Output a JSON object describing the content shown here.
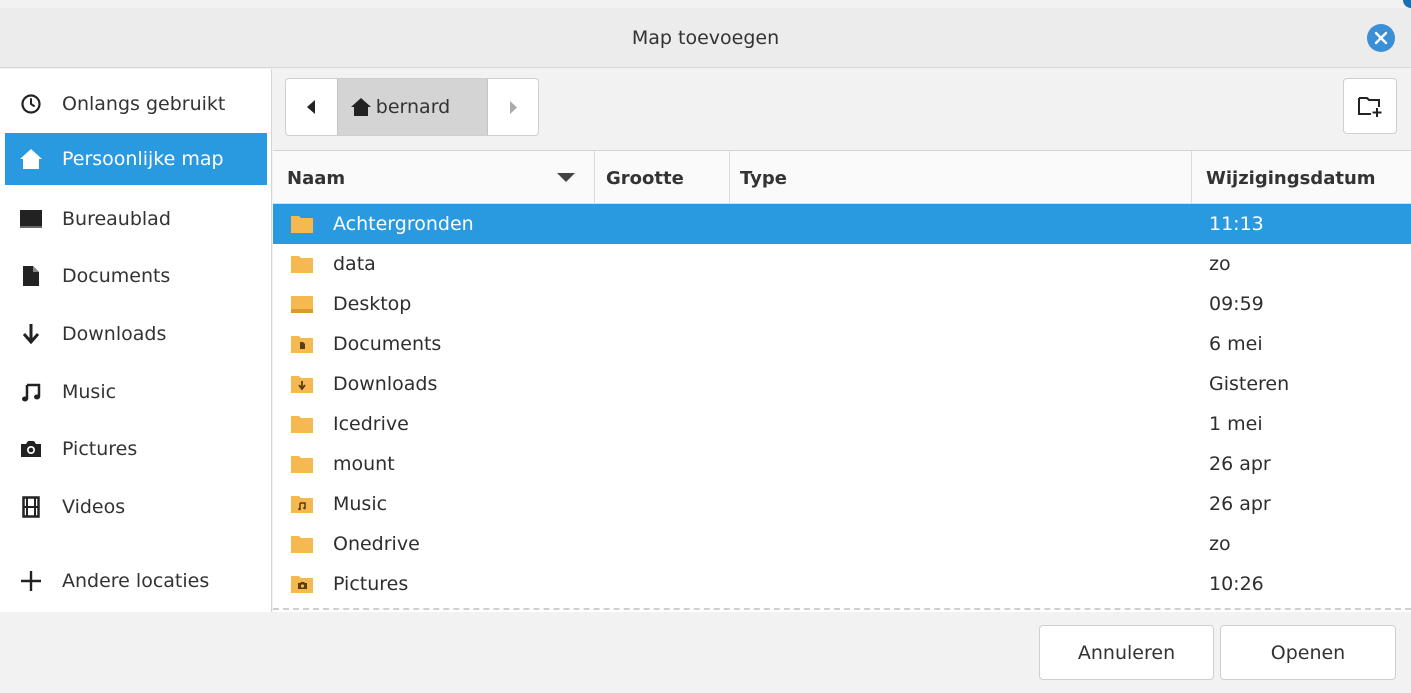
{
  "window": {
    "title": "Map toevoegen"
  },
  "sidebar": {
    "items": [
      {
        "label": "Onlangs gebruikt",
        "icon": "clock-icon"
      },
      {
        "label": "Persoonlijke map",
        "icon": "home-icon",
        "active": true
      },
      {
        "label": "Bureaublad",
        "icon": "desktop-icon"
      },
      {
        "label": "Documents",
        "icon": "document-icon"
      },
      {
        "label": "Downloads",
        "icon": "download-icon"
      },
      {
        "label": "Music",
        "icon": "music-icon"
      },
      {
        "label": "Pictures",
        "icon": "camera-icon"
      },
      {
        "label": "Videos",
        "icon": "film-icon"
      },
      {
        "label": "Andere locaties",
        "icon": "plus-icon"
      }
    ]
  },
  "pathbar": {
    "current": "bernard"
  },
  "columns": {
    "name": "Naam",
    "size": "Grootte",
    "type": "Type",
    "date": "Wijzigingsdatum"
  },
  "files": [
    {
      "name": "Achtergronden",
      "date": "11:13",
      "icon": "folder-icon",
      "selected": true
    },
    {
      "name": "data",
      "date": "zo",
      "icon": "folder-icon"
    },
    {
      "name": "Desktop",
      "date": "09:59",
      "icon": "desktop-folder-icon"
    },
    {
      "name": "Documents",
      "date": "6 mei",
      "icon": "documents-folder-icon"
    },
    {
      "name": "Downloads",
      "date": "Gisteren",
      "icon": "downloads-folder-icon"
    },
    {
      "name": "Icedrive",
      "date": "1 mei",
      "icon": "folder-icon"
    },
    {
      "name": "mount",
      "date": "26 apr",
      "icon": "folder-icon"
    },
    {
      "name": "Music",
      "date": "26 apr",
      "icon": "music-folder-icon"
    },
    {
      "name": "Onedrive",
      "date": "zo",
      "icon": "folder-icon"
    },
    {
      "name": "Pictures",
      "date": "10:26",
      "icon": "pictures-folder-icon"
    }
  ],
  "footer": {
    "cancel": "Annuleren",
    "open": "Openen"
  },
  "colors": {
    "accent": "#2a9ae0",
    "folder": "#f5b94f",
    "close": "#3a8fd6"
  }
}
